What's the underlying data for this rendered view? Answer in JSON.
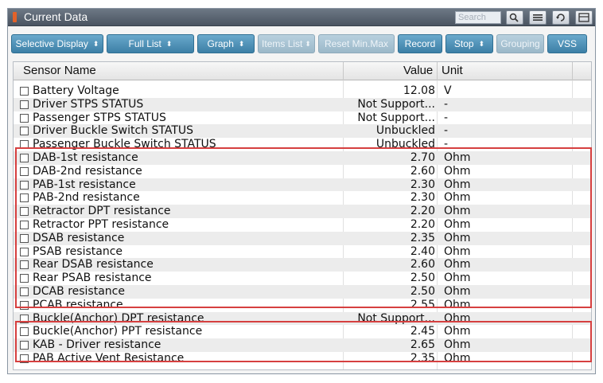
{
  "window": {
    "title": "Current Data",
    "search_placeholder": "Search",
    "icons": [
      "zoom-icon",
      "list-view-icon",
      "retry-icon",
      "menu-icon"
    ]
  },
  "toolbar": {
    "selective_display": "Selective Display",
    "full_list": "Full List",
    "graph": "Graph",
    "items_list": "Items List",
    "reset_min_max": "Reset Min.Max",
    "record": "Record",
    "stop": "Stop",
    "grouping": "Grouping",
    "vss": "VSS"
  },
  "table": {
    "headers": {
      "name": "Sensor Name",
      "value": "Value",
      "unit": "Unit"
    },
    "rows": [
      {
        "name": "Battery Voltage",
        "value": "12.08",
        "unit": "V"
      },
      {
        "name": "Driver STPS STATUS",
        "value": "Not Support...",
        "unit": "-"
      },
      {
        "name": "Passenger STPS STATUS",
        "value": "Not Support...",
        "unit": "-"
      },
      {
        "name": "Driver Buckle Switch STATUS",
        "value": "Unbuckled",
        "unit": "-"
      },
      {
        "name": "Passenger Buckle Switch STATUS",
        "value": "Unbuckled",
        "unit": "-"
      },
      {
        "name": "DAB-1st resistance",
        "value": "2.70",
        "unit": "Ohm"
      },
      {
        "name": "DAB-2nd resistance",
        "value": "2.60",
        "unit": "Ohm"
      },
      {
        "name": "PAB-1st resistance",
        "value": "2.30",
        "unit": "Ohm"
      },
      {
        "name": "PAB-2nd resistance",
        "value": "2.30",
        "unit": "Ohm"
      },
      {
        "name": "Retractor DPT resistance",
        "value": "2.20",
        "unit": "Ohm"
      },
      {
        "name": "Retractor PPT resistance",
        "value": "2.20",
        "unit": "Ohm"
      },
      {
        "name": "DSAB resistance",
        "value": "2.35",
        "unit": "Ohm"
      },
      {
        "name": "PSAB resistance",
        "value": "2.40",
        "unit": "Ohm"
      },
      {
        "name": "Rear DSAB resistance",
        "value": "2.60",
        "unit": "Ohm"
      },
      {
        "name": "Rear PSAB resistance",
        "value": "2.50",
        "unit": "Ohm"
      },
      {
        "name": "DCAB resistance",
        "value": "2.50",
        "unit": "Ohm"
      },
      {
        "name": "PCAB resistance",
        "value": "2.55",
        "unit": "Ohm"
      },
      {
        "name": "Buckle(Anchor) DPT resistance",
        "value": "Not Support...",
        "unit": "Ohm"
      },
      {
        "name": "Buckle(Anchor) PPT resistance",
        "value": "2.45",
        "unit": "Ohm"
      },
      {
        "name": "KAB - Driver resistance",
        "value": "2.65",
        "unit": "Ohm"
      },
      {
        "name": "PAB Active Vent Resistance",
        "value": "2.35",
        "unit": "Ohm"
      }
    ]
  },
  "colors": {
    "highlight": "#d64040",
    "button": "#3c7fa6",
    "titlebar": "#4a5461"
  }
}
